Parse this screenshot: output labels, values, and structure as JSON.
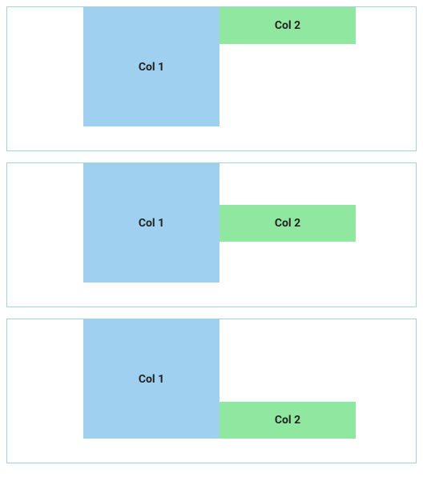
{
  "examples": [
    {
      "alignment": "flex-start",
      "col1_label": "Col 1",
      "col2_label": "Col 2"
    },
    {
      "alignment": "center",
      "col1_label": "Col 1",
      "col2_label": "Col 2"
    },
    {
      "alignment": "flex-end",
      "col1_label": "Col 1",
      "col2_label": "Col 2"
    }
  ]
}
